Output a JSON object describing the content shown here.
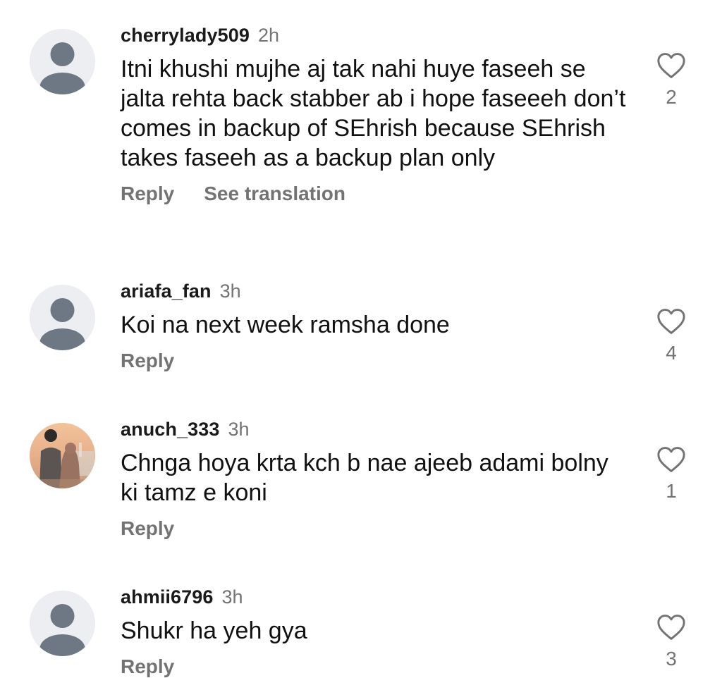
{
  "comments": [
    {
      "username": "cherrylady509",
      "time": "2h",
      "text": "Itni khushi mujhe aj tak nahi huye faseeh se jalta rehta back stabber ab i hope faseeeh don’t comes in backup of SEhrish because SEhrish takes faseeh as a backup plan only",
      "reply_label": "Reply",
      "translation_label": "See translation",
      "likes": "2",
      "avatar": "default-avatar-icon"
    },
    {
      "username": "ariafa_fan",
      "time": "3h",
      "text": "Koi na next week ramsha done",
      "reply_label": "Reply",
      "likes": "4",
      "avatar": "default-avatar-icon"
    },
    {
      "username": "anuch_333",
      "time": "3h",
      "text": "Chnga hoya krta kch b nae ajeeb adami bolny ki tamz e koni",
      "reply_label": "Reply",
      "likes": "1",
      "avatar": "photo-avatar"
    },
    {
      "username": "ahmii6796",
      "time": "3h",
      "text": "Shukr ha yeh gya",
      "reply_label": "Reply",
      "likes": "3",
      "avatar": "default-avatar-icon"
    }
  ],
  "colors": {
    "text": "#111111",
    "secondary": "#737373",
    "avatar_bg": "#eceef1",
    "avatar_glyph": "#6e7784"
  }
}
